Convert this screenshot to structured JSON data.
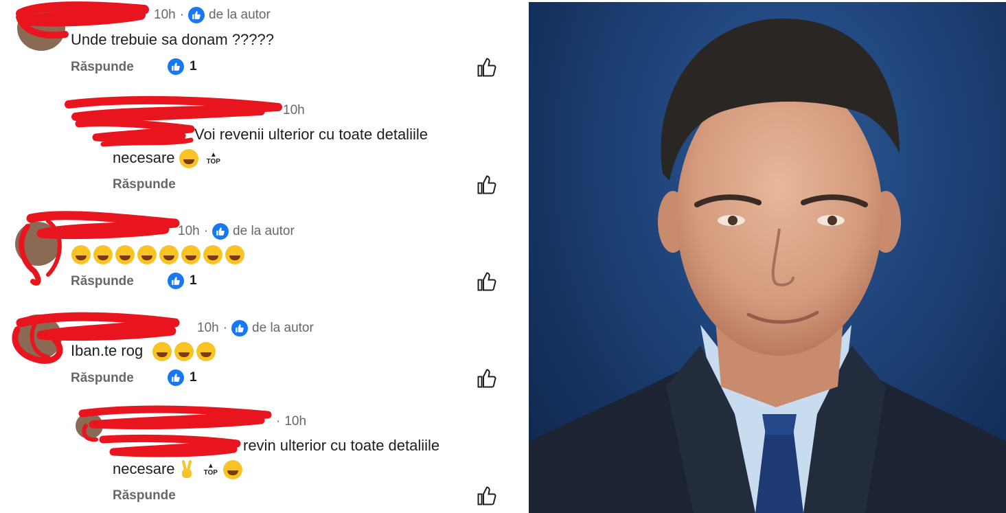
{
  "comments": [
    {
      "time": "10h",
      "badge": "de la autor",
      "text": "Unde trebuie sa donam ?????",
      "reply": "Răspunde",
      "likes": "1"
    },
    {
      "time": "10h",
      "text_line1": "Voi revenii ulterior cu toate detaliile",
      "text_line2": "necesare",
      "top": "TOP",
      "reply": "Răspunde"
    },
    {
      "time": "10h",
      "badge": "de la autor",
      "reply": "Răspunde",
      "likes": "1"
    },
    {
      "time": "10h",
      "badge": "de la autor",
      "text": "Iban.te rog",
      "reply": "Răspunde",
      "likes": "1"
    },
    {
      "time": "10h",
      "text_line1": "revin ulterior cu toate detaliile",
      "text_line2": "necesare",
      "top": "TOP",
      "reply": "Răspunde"
    }
  ],
  "colors": {
    "like_blue": "#1877f2",
    "redaction_red": "#e8141e",
    "photo_bg": "#1f447a"
  },
  "icons": {
    "like": "thumbs-up-icon",
    "author_badge": "like-badge-icon",
    "top": "top-arrow-icon"
  }
}
